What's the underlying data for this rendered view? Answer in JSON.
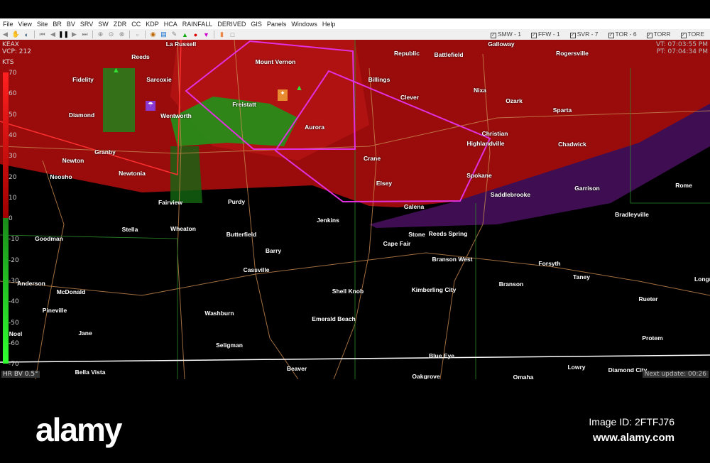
{
  "menu": [
    "File",
    "View",
    "Site",
    "BR",
    "BV",
    "SRV",
    "SW",
    "ZDR",
    "CC",
    "KDP",
    "HCA",
    "RAINFALL",
    "DERIVED",
    "GIS",
    "Panels",
    "Windows",
    "Help"
  ],
  "warnings": [
    {
      "label": "SMW - 1"
    },
    {
      "label": "FFW - 1"
    },
    {
      "label": "SVR - 7"
    },
    {
      "label": "TOR - 6"
    },
    {
      "label": "TORR"
    },
    {
      "label": "TORE"
    }
  ],
  "radar": {
    "site": "KEAX",
    "vcp": "VCP: 212",
    "units": "KTS",
    "vt": "VT: 07:03:55 PM",
    "pt": "PT: 07:04:34 PM",
    "product": "HR BV 0.5°",
    "next_update": "Next update: 00:26"
  },
  "legend_ticks": [
    "70",
    "60",
    "50",
    "40",
    "30",
    "20",
    "10",
    "0",
    "-10",
    "-20",
    "-30",
    "-40",
    "-50",
    "-60",
    "-70"
  ],
  "towns": [
    "La Russell",
    "Reeds",
    "Mount Vernon",
    "Republic",
    "Battlefield",
    "Galloway",
    "Rogersville",
    "Fidelity",
    "Sarcoxie",
    "Billings",
    "Clever",
    "Nixa",
    "Ozark",
    "Freistatt",
    "Diamond",
    "Wentworth",
    "Sparta",
    "Aurora",
    "Christian",
    "Highlandville",
    "Chadwick",
    "Granby",
    "Newton",
    "Crane",
    "Newtonia",
    "Neosho",
    "Spokane",
    "Saddlebrooke",
    "Elsey",
    "Garrison",
    "Rome",
    "Fairview",
    "Purdy",
    "Galena",
    "Bradleyville",
    "Stella",
    "Wheaton",
    "Jenkins",
    "Stone",
    "Reeds Spring",
    "Goodman",
    "Butterfield",
    "Cape Fair",
    "Barry",
    "Branson West",
    "Forsyth",
    "Cassville",
    "Taney",
    "Anderson",
    "McDonald",
    "Shell Knob",
    "Kimberling City",
    "Branson",
    "Longr",
    "Rueter",
    "Pineville",
    "Washburn",
    "Emerald Beach",
    "Jane",
    "Noel",
    "Protem",
    "Seligman",
    "Blue Eye",
    "Beaver",
    "Lowry",
    "Diamond City",
    "Bella Vista",
    "Oakgrove",
    "Omaha"
  ],
  "footer": {
    "logo": "alamy",
    "image_id": "Image ID: 2FTFJ76",
    "site": "www.alamy.com"
  },
  "colors": {
    "reflect_red": "#b01010",
    "polygon": "#e030e0",
    "green": "#1a9a1a",
    "purple": "#4a1060"
  }
}
